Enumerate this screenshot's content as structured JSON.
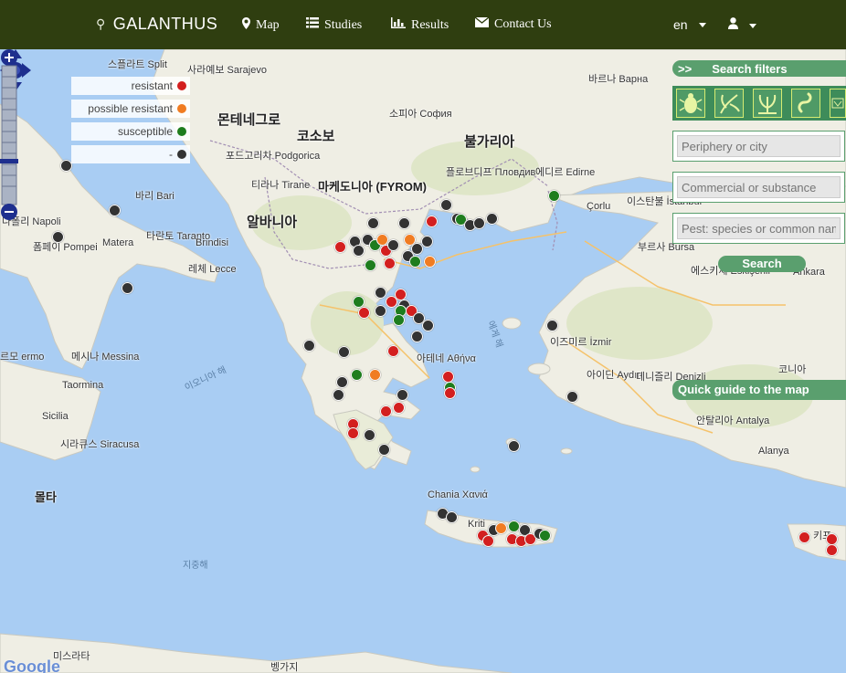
{
  "navbar": {
    "brand": "GALANTHUS",
    "items": [
      {
        "label": "Map",
        "icon": "map-marker-icon"
      },
      {
        "label": "Studies",
        "icon": "list-icon"
      },
      {
        "label": "Results",
        "icon": "bar-chart-icon"
      },
      {
        "label": "Contact Us",
        "icon": "envelope-icon"
      }
    ],
    "language": "en",
    "user_icon": "user-icon"
  },
  "legend": [
    {
      "label": "resistant",
      "color": "#d31f1f"
    },
    {
      "label": "possible resistant",
      "color": "#f07c22"
    },
    {
      "label": "susceptible",
      "color": "#1e7d1e"
    },
    {
      "label": "-",
      "color": "#333333"
    }
  ],
  "search_filters": {
    "header": "Search filters",
    "arrow": ">>",
    "filter_icons": [
      "bug-icon",
      "weed-icon",
      "plant-icon",
      "worm-icon"
    ],
    "periphery_placeholder": "Periphery or city",
    "commercial_placeholder": "Commercial or substance",
    "pest_placeholder": "Pest: species or common nam",
    "search_label": "Search"
  },
  "quick_guide": "Quick guide to the map",
  "map_labels": {
    "split": "스플라트 Split",
    "sarajevo": "사라예보 Sarajevo",
    "montenegro": "몬테네그로",
    "kosovo": "코소보",
    "podgorica": "포드고리차 Podgorica",
    "tirana": "티라나 Tirane",
    "macedonia": "마케도니아 (FYROM)",
    "albania": "알바니아",
    "bulgaria": "불가리아",
    "sofia": "소피아 София",
    "plovdiv": "플로브디프 Пловдив",
    "varna": "바르나 Варна",
    "edirne": "에디르 Edirne",
    "istanbul": "이스탄불 İstanbul",
    "corlu": "Çorlu",
    "bursa": "부르사 Bursa",
    "eskisehir": "에스키셰 Eskişehir",
    "ankara": "Ankara",
    "izmir": "이즈미르 İzmir",
    "aydin": "아이딘 Aydın",
    "denizli": "데니즐리 Denizli",
    "konya": "코니아",
    "antalya": "안탈리아 Antalya",
    "alanya": "Alanya",
    "bari": "바리 Bari",
    "napoli": "나폴리 Napoli",
    "pompei": "폼페이 Pompei",
    "matera": "Matera",
    "taranto": "타란토 Taranto",
    "brindisi": "Brindisi",
    "lecce": "레체 Lecce",
    "messina": "메시나 Messina",
    "taormina": "Taormina",
    "sicilia": "Sicilia",
    "siracusa": "시라큐스 Siracusa",
    "malta": "몰타",
    "athens": "아테네 Αθήνα",
    "chania": "Chania Χανιά",
    "kriti": "Kriti",
    "ionian_sea": "이오니아 해",
    "aegean_sea": "에게 해",
    "mediterranean": "지중해",
    "benghazi": "벵가지",
    "misrata": "미스라타",
    "palermo": "르모 ermo",
    "cyprus": "키프"
  },
  "google_logo": "Google"
}
